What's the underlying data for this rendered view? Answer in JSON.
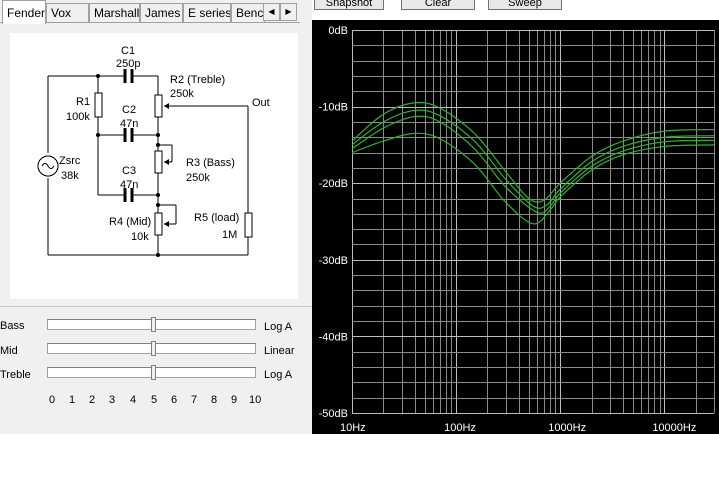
{
  "tabs": [
    "Fender",
    "Vox",
    "Marshall",
    "James",
    "E series",
    "Benc"
  ],
  "tab_arrows": {
    "left": "◀",
    "right": "▶"
  },
  "buttons": {
    "snapshot": "Snapshot",
    "clear": "Clear",
    "sweep": "Sweep"
  },
  "circuit": {
    "c1": "C1",
    "c1_value": "250p",
    "r2": "R2 (Treble)",
    "r2_value": "250k",
    "r1": "R1",
    "r1_value": "100k",
    "c2": "C2",
    "c2_value": "47n",
    "out": "Out",
    "zsrc": "Zsrc",
    "zsrc_value": "38k",
    "r3": "R3 (Bass)",
    "r3_value": "250k",
    "c3": "C3",
    "c3_value": "47n",
    "r4": "R4 (Mid)",
    "r4_value": "10k",
    "r5": "R5 (load)",
    "r5_value": "1M"
  },
  "sliders": [
    {
      "label": "Bass",
      "mode": "Log A",
      "position": 5
    },
    {
      "label": "Mid",
      "mode": "Linear",
      "position": 5
    },
    {
      "label": "Treble",
      "mode": "Log A",
      "position": 5
    }
  ],
  "scale": [
    "0",
    "1",
    "2",
    "3",
    "4",
    "5",
    "6",
    "7",
    "8",
    "9",
    "10"
  ],
  "chart_data": {
    "type": "line",
    "x_scale": "log",
    "xlim": [
      10,
      30000
    ],
    "ylim": [
      -50,
      0
    ],
    "y_ticks": [
      "0dB",
      "-10dB",
      "-20dB",
      "-30dB",
      "-40dB",
      "-50dB"
    ],
    "x_ticks": [
      "10Hz",
      "100Hz",
      "1000Hz",
      "10000Hz"
    ],
    "grid": true,
    "line_color": "#2bb52b",
    "series": [
      {
        "points": [
          [
            10,
            -14.5
          ],
          [
            20,
            -11
          ],
          [
            40,
            -9.5
          ],
          [
            70,
            -10.2
          ],
          [
            150,
            -13.5
          ],
          [
            300,
            -18.5
          ],
          [
            500,
            -22
          ],
          [
            700,
            -22.2
          ],
          [
            1000,
            -20
          ],
          [
            2000,
            -16.5
          ],
          [
            4000,
            -14.5
          ],
          [
            10000,
            -13.2
          ],
          [
            30000,
            -13
          ]
        ]
      },
      {
        "points": [
          [
            10,
            -15
          ],
          [
            20,
            -12
          ],
          [
            40,
            -10.5
          ],
          [
            70,
            -11.2
          ],
          [
            150,
            -14.5
          ],
          [
            300,
            -19.5
          ],
          [
            550,
            -23
          ],
          [
            750,
            -22.8
          ],
          [
            1000,
            -20.8
          ],
          [
            2000,
            -17.2
          ],
          [
            4000,
            -15.2
          ],
          [
            10000,
            -14
          ],
          [
            30000,
            -13.8
          ]
        ]
      },
      {
        "points": [
          [
            10,
            -15.5
          ],
          [
            20,
            -12.8
          ],
          [
            40,
            -11.3
          ],
          [
            70,
            -12
          ],
          [
            150,
            -15.5
          ],
          [
            300,
            -20.5
          ],
          [
            600,
            -23.8
          ],
          [
            800,
            -23
          ],
          [
            1000,
            -21.3
          ],
          [
            2000,
            -17.8
          ],
          [
            4000,
            -15.8
          ],
          [
            10000,
            -14.6
          ],
          [
            30000,
            -14.4
          ]
        ]
      },
      {
        "points": [
          [
            10,
            -16
          ],
          [
            20,
            -14.5
          ],
          [
            40,
            -13.5
          ],
          [
            70,
            -14.2
          ],
          [
            150,
            -17.5
          ],
          [
            300,
            -22.5
          ],
          [
            550,
            -25.3
          ],
          [
            800,
            -23.5
          ],
          [
            1000,
            -21.8
          ],
          [
            2000,
            -18.3
          ],
          [
            4000,
            -16.3
          ],
          [
            10000,
            -15.2
          ],
          [
            30000,
            -15
          ]
        ]
      }
    ]
  }
}
